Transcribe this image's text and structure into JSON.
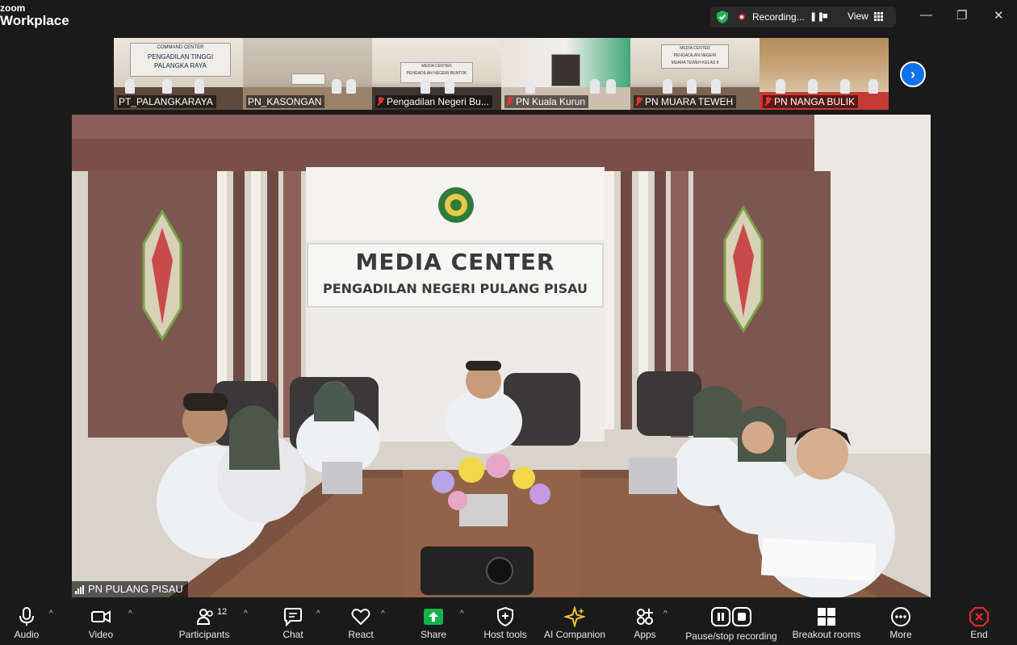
{
  "app": {
    "brand_line1": "zoom",
    "brand_line2": "Workplace"
  },
  "titlebar": {
    "recording_label": "Recording...",
    "view_label": "View",
    "controls": {
      "minimize": "—",
      "restore": "❐",
      "close": "✕"
    }
  },
  "participants_strip": [
    {
      "name": "PT_PALANGKARAYA",
      "muted": false,
      "sign_lines": [
        "COMMAND CENTER",
        "PENGADILAN TINGGI",
        "PALANGKA RAYA"
      ]
    },
    {
      "name": "PN_KASONGAN",
      "muted": false,
      "sign_lines": []
    },
    {
      "name": "Pengadilan Negeri Bu...",
      "muted": true,
      "sign_lines": [
        "MEDIA CENTER",
        "PENGADILAN NEGERI BUNTOK"
      ]
    },
    {
      "name": "PN Kuala Kurun",
      "muted": true,
      "sign_lines": []
    },
    {
      "name": "PN MUARA TEWEH",
      "muted": true,
      "sign_lines": [
        "MEDIA CENTER",
        "PENGADILAN NEGERI",
        "MUARA TEWEH KELAS II"
      ]
    },
    {
      "name": "PN NANGA BULIK",
      "muted": true,
      "sign_lines": []
    }
  ],
  "main_video": {
    "speaker_name": "PN PULANG PISAU",
    "sign_title": "MEDIA CENTER",
    "sign_subtitle": "PENGADILAN NEGERI PULANG PISAU"
  },
  "toolbar": {
    "participants_count": "12",
    "items": {
      "audio": "Audio",
      "video": "Video",
      "participants": "Participants",
      "chat": "Chat",
      "react": "React",
      "share": "Share",
      "host_tools": "Host tools",
      "ai_companion": "AI Companion",
      "apps": "Apps",
      "pause_recording": "Pause/stop recording",
      "breakout": "Breakout rooms",
      "more": "More",
      "end": "End"
    }
  },
  "colors": {
    "accent_blue": "#0e72ed",
    "share_green": "#13b34b",
    "record_red": "#e02828",
    "ai_gold": "#f2c230",
    "end_red": "#e0282e"
  }
}
